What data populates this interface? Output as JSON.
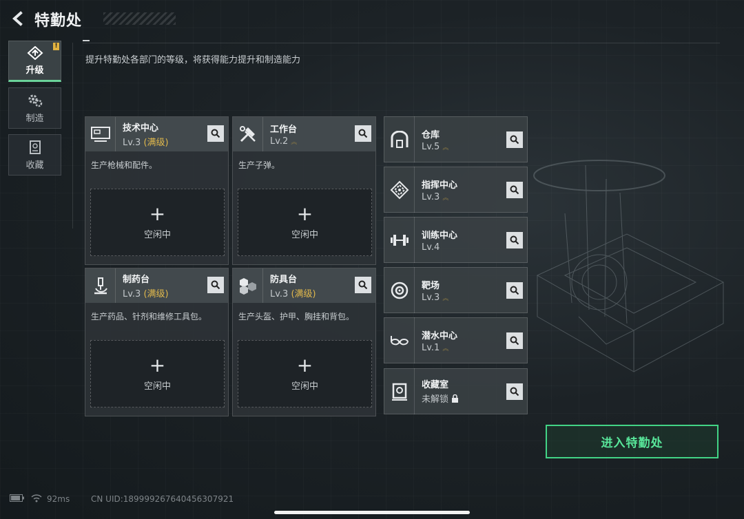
{
  "header": {
    "title": "特勤处",
    "subtitle": "提升特勤处各部门的等级，将获得能力提升和制造能力"
  },
  "tabs": [
    {
      "label": "升级",
      "icon": "upgrade-icon",
      "active": true,
      "alert": true
    },
    {
      "label": "制造",
      "icon": "gears-icon",
      "active": false
    },
    {
      "label": "收藏",
      "icon": "collection-icon",
      "active": false
    }
  ],
  "cards": [
    {
      "name": "技术中心",
      "level": "Lv.3",
      "max_label": "(满级)",
      "desc": "生产枪械和配件。",
      "slot_label": "空闲中",
      "icon": "monitor-icon"
    },
    {
      "name": "工作台",
      "level": "Lv.2",
      "max_label": "",
      "desc": "生产子弹。",
      "slot_label": "空闲中",
      "icon": "tools-icon"
    },
    {
      "name": "制药台",
      "level": "Lv.3",
      "max_label": "(满级)",
      "desc": "生产药品、针剂和维修工具包。",
      "slot_label": "空闲中",
      "icon": "microscope-icon"
    },
    {
      "name": "防具台",
      "level": "Lv.3",
      "max_label": "(满级)",
      "desc": "生产头盔、护甲、胸挂和背包。",
      "slot_label": "空闲中",
      "icon": "cubes-icon"
    }
  ],
  "facilities": [
    {
      "name": "仓库",
      "level": "Lv.5",
      "icon": "warehouse-icon"
    },
    {
      "name": "指挥中心",
      "level": "Lv.3",
      "icon": "command-icon"
    },
    {
      "name": "训练中心",
      "level": "Lv.4",
      "icon": "dumbbell-icon"
    },
    {
      "name": "靶场",
      "level": "Lv.3",
      "icon": "target-icon"
    },
    {
      "name": "潜水中心",
      "level": "Lv.1",
      "icon": "diving-mask-icon"
    },
    {
      "name": "收藏室",
      "level": "未解锁",
      "icon": "vault-icon",
      "locked": true
    }
  ],
  "enter_button": "进入特勤处",
  "status": {
    "ping": "92ms",
    "uid": "CN UID:18999926764045630792​1"
  },
  "colors": {
    "accent_green": "#42d586",
    "max_gold": "#e0b84c"
  }
}
